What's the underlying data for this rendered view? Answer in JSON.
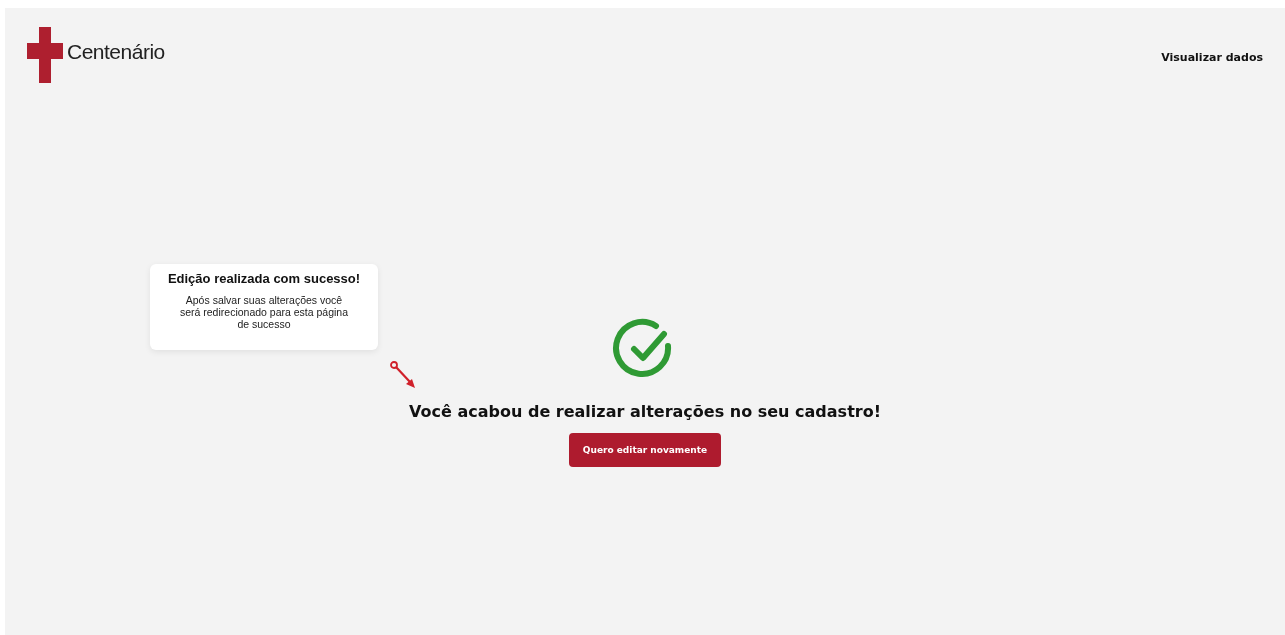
{
  "header": {
    "logo_text": "Centenário",
    "nav_link": "Visualizar dados"
  },
  "callout": {
    "title": "Edição realizada com sucesso!",
    "text": "Após salvar suas alterações você será redirecionado para esta página de sucesso"
  },
  "success": {
    "message": "Você acabou de realizar alterações no seu cadastro!",
    "button": "Quero editar novamente"
  }
}
